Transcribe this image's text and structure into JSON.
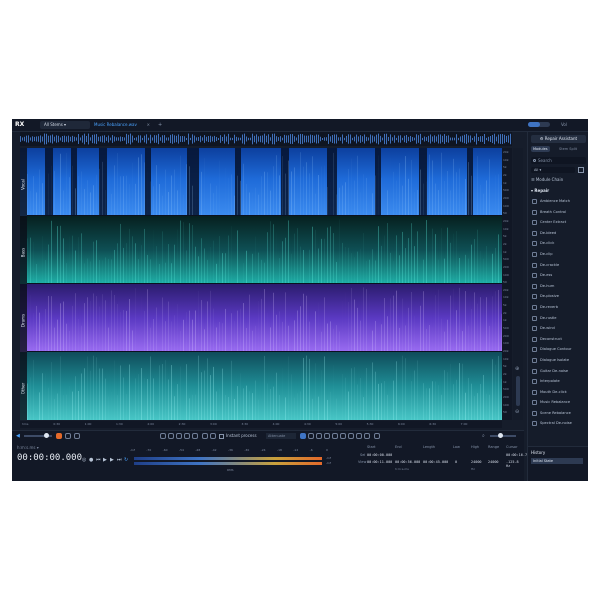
{
  "app": {
    "logo": "RX",
    "volume_label": "Vol"
  },
  "tabs": {
    "stems": "All Stems",
    "file": "Music Rebalance.wav",
    "close": "×",
    "add": "+"
  },
  "lanes": [
    {
      "label": "Vocal",
      "color": "#2f7fe0"
    },
    {
      "label": "Bass",
      "color": "#1fa6a0"
    },
    {
      "label": "Drums",
      "color": "#7d52e0"
    },
    {
      "label": "Other",
      "color": "#28b0b0"
    }
  ],
  "freq_axis": [
    "20k",
    "10k",
    "5k",
    "2k",
    "1k",
    "500",
    "200",
    "100",
    "50",
    "20k",
    "10k",
    "5k",
    "2k",
    "1k",
    "500",
    "200",
    "100",
    "50",
    "20k",
    "10k",
    "5k",
    "2k",
    "1k",
    "500",
    "200",
    "100",
    "20k",
    "10k",
    "5k",
    "2k",
    "1k",
    "500",
    "200",
    "100",
    "50"
  ],
  "time_axis": [
    "hms",
    "0:30",
    "1:00",
    "1:30",
    "2:00",
    "2:30",
    "3:00",
    "3:30",
    "4:00",
    "4:30",
    "5:00",
    "5:30",
    "6:00",
    "6:30",
    "7:00"
  ],
  "toolbar": {
    "instant_process": "Instant process",
    "attenuate": "Attenuate"
  },
  "transport": {
    "time_label": "h:m:s.ms",
    "timecode": "00:00:00.000",
    "meter_scale": [
      "-Inf",
      "-70",
      "-60",
      "-54",
      "-48",
      "-42",
      "-36",
      "-30",
      "-24",
      "-18",
      "-12",
      "-6",
      "0"
    ],
    "meter_peak": [
      "-Inf",
      "-Inf"
    ],
    "meter_label": "RMS"
  },
  "selection": {
    "headers": [
      "Start",
      "End",
      "Length",
      "Low",
      "High",
      "Range",
      "Cursor"
    ],
    "rows": [
      {
        "label": "Sel",
        "start": "00:00:00.000",
        "end": "",
        "length": "",
        "low": "",
        "high": "",
        "range": "",
        "cursor": "00:00:16.747"
      },
      {
        "label": "View",
        "start": "00:00:11.000",
        "end": "00:00:56.000",
        "length": "00:00:45.000",
        "low": "0",
        "high": "24000",
        "range": "24000",
        "cursor": "-125.8 Hz"
      }
    ],
    "foot_time": "h:m:s.ms",
    "foot_hz": "Hz"
  },
  "panel": {
    "repair_assistant": "Repair Assistant",
    "modes": [
      "Modules",
      "Stem Split"
    ],
    "search_placeholder": "Search",
    "filter": "All",
    "module_chain": "Module Chain",
    "repair_header": "Repair",
    "modules": [
      "Ambience Match",
      "Breath Control",
      "Center Extract",
      "De-bleed",
      "De-click",
      "De-clip",
      "De-crackle",
      "De-ess",
      "De-hum",
      "De-plosive",
      "De-reverb",
      "De-rustle",
      "De-wind",
      "Deconstruct",
      "Dialogue Contour",
      "Dialogue Isolate",
      "Guitar De-noise",
      "Interpolate",
      "Mouth De-click",
      "Music Rebalance",
      "Scene Rebalance",
      "Spectral De-noise"
    ]
  },
  "history": {
    "title": "History",
    "state": "Initial State"
  }
}
